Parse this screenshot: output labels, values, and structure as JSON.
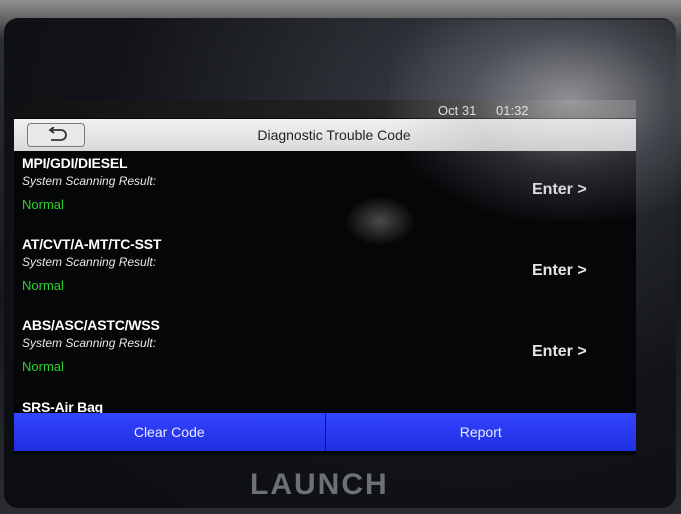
{
  "status_bar": {
    "date": "Oct 31",
    "time": "01:32"
  },
  "header": {
    "title": "Diagnostic Trouble Code",
    "back_icon": "back-arrow-icon"
  },
  "systems": [
    {
      "name": "MPI/GDI/DIESEL",
      "scan_label": "System Scanning Result:",
      "result": "Normal",
      "action": "Enter >"
    },
    {
      "name": "AT/CVT/A-MT/TC-SST",
      "scan_label": "System Scanning Result:",
      "result": "Normal",
      "action": "Enter >"
    },
    {
      "name": "ABS/ASC/ASTC/WSS",
      "scan_label": "System Scanning Result:",
      "result": "Normal",
      "action": "Enter >"
    }
  ],
  "partial_item": "SRS-Air Bag",
  "footer": {
    "clear_code": "Clear Code",
    "report": "Report"
  },
  "brand": "LAUNCH",
  "colors": {
    "normal": "#2fd12f",
    "button": "#2536f0"
  }
}
